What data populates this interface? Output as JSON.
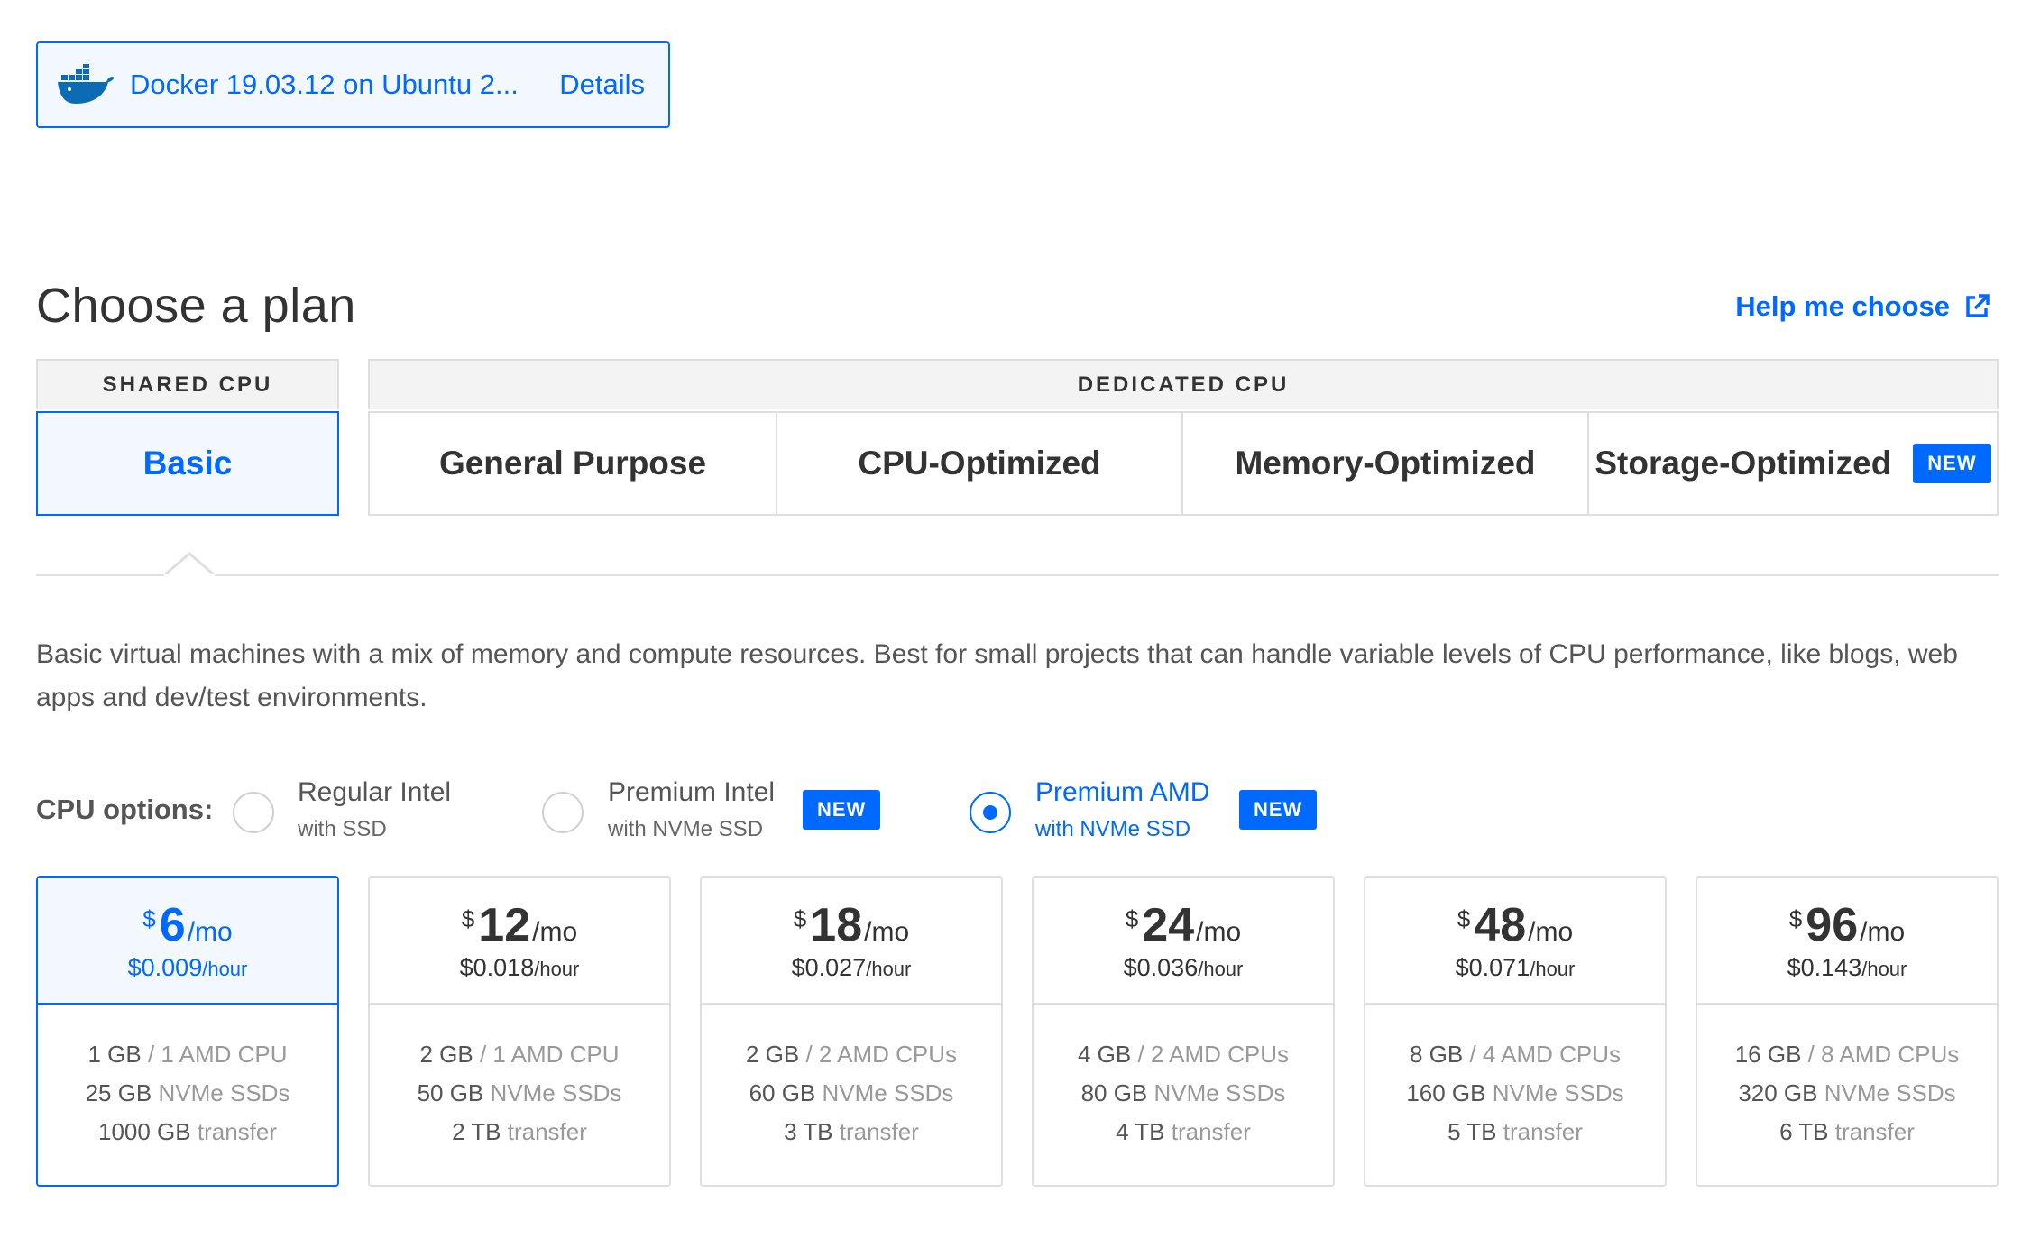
{
  "selected_image": {
    "icon": "docker-whale-icon",
    "name": "Docker 19.03.12 on Ubuntu 2...",
    "details_label": "Details"
  },
  "section": {
    "title": "Choose a plan",
    "help_label": "Help me choose"
  },
  "plan_groups": {
    "shared": "SHARED CPU",
    "dedicated": "DEDICATED CPU"
  },
  "plan_tabs": [
    {
      "label": "Basic",
      "active": true
    },
    {
      "label": "General Purpose"
    },
    {
      "label": "CPU-Optimized"
    },
    {
      "label": "Memory-Optimized"
    },
    {
      "label": "Storage-Optimized",
      "badge": "NEW"
    }
  ],
  "description": "Basic virtual machines with a mix of memory and compute resources. Best for small projects that can handle variable levels of CPU performance, like blogs, web apps and dev/test environments.",
  "cpu_options": {
    "label": "CPU options:",
    "options": [
      {
        "title": "Regular Intel",
        "subtitle": "with SSD",
        "selected": false
      },
      {
        "title": "Premium Intel",
        "subtitle": "with NVMe SSD",
        "badge": "NEW",
        "selected": false
      },
      {
        "title": "Premium AMD",
        "subtitle": "with NVMe SSD",
        "badge": "NEW",
        "selected": true
      }
    ]
  },
  "plans": [
    {
      "currency": "$",
      "amount": "6",
      "per": "/mo",
      "hourly": "$0.009",
      "hourly_unit": "/hour",
      "ram": "1 GB",
      "cpu": "/ 1 AMD CPU",
      "disk": "25 GB",
      "disk_type": "NVMe SSDs",
      "transfer": "1000 GB",
      "transfer_label": "transfer",
      "active": true
    },
    {
      "currency": "$",
      "amount": "12",
      "per": "/mo",
      "hourly": "$0.018",
      "hourly_unit": "/hour",
      "ram": "2 GB",
      "cpu": "/ 1 AMD CPU",
      "disk": "50 GB",
      "disk_type": "NVMe SSDs",
      "transfer": "2 TB",
      "transfer_label": "transfer"
    },
    {
      "currency": "$",
      "amount": "18",
      "per": "/mo",
      "hourly": "$0.027",
      "hourly_unit": "/hour",
      "ram": "2 GB",
      "cpu": "/ 2 AMD CPUs",
      "disk": "60 GB",
      "disk_type": "NVMe SSDs",
      "transfer": "3 TB",
      "transfer_label": "transfer"
    },
    {
      "currency": "$",
      "amount": "24",
      "per": "/mo",
      "hourly": "$0.036",
      "hourly_unit": "/hour",
      "ram": "4 GB",
      "cpu": "/ 2 AMD CPUs",
      "disk": "80 GB",
      "disk_type": "NVMe SSDs",
      "transfer": "4 TB",
      "transfer_label": "transfer"
    },
    {
      "currency": "$",
      "amount": "48",
      "per": "/mo",
      "hourly": "$0.071",
      "hourly_unit": "/hour",
      "ram": "8 GB",
      "cpu": "/ 4 AMD CPUs",
      "disk": "160 GB",
      "disk_type": "NVMe SSDs",
      "transfer": "5 TB",
      "transfer_label": "transfer"
    },
    {
      "currency": "$",
      "amount": "96",
      "per": "/mo",
      "hourly": "$0.143",
      "hourly_unit": "/hour",
      "ram": "16 GB",
      "cpu": "/ 8 AMD CPUs",
      "disk": "320 GB",
      "disk_type": "NVMe SSDs",
      "transfer": "6 TB",
      "transfer_label": "transfer"
    }
  ],
  "colors": {
    "accent": "#0069ff",
    "selected_bg": "#f3f8ff",
    "border": "#dfdfdf",
    "muted_text": "#999999"
  }
}
